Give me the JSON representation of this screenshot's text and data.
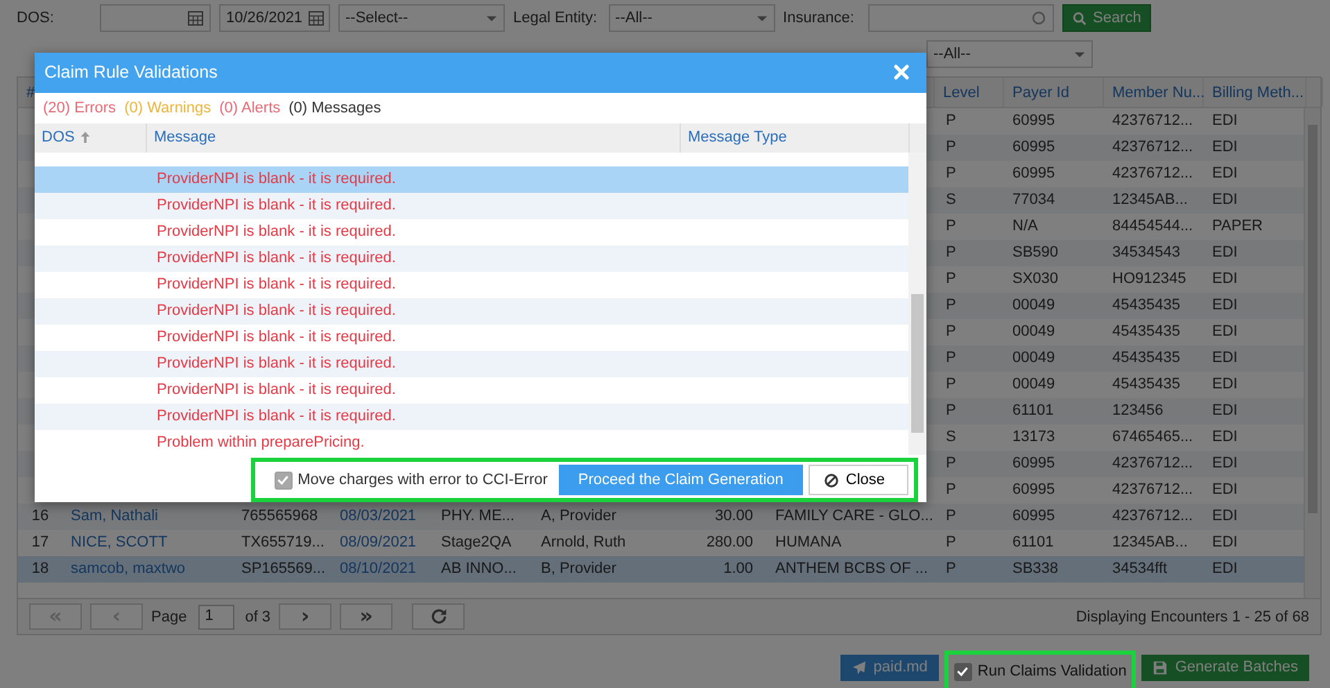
{
  "filters": {
    "rows": [
      [
        {
          "kind": "label",
          "text": "DOS:"
        },
        {
          "kind": "date"
        },
        {
          "kind": "date",
          "value": "10/26/2021"
        },
        {
          "kind": "select",
          "value": "--Select--"
        },
        {
          "kind": "label",
          "text": "Legal Entity:"
        },
        {
          "kind": "select",
          "value": "--All--"
        },
        {
          "kind": "label",
          "text": "Insurance:"
        },
        {
          "kind": "text"
        },
        {
          "kind": "button",
          "text": "Search"
        }
      ],
      [
        {
          "kind": "select",
          "value": "--All--"
        }
      ]
    ]
  },
  "grid": {
    "header": {
      "number": "#",
      "level": "Level",
      "payer_id": "Payer Id",
      "member_number": "Member Nu...",
      "billing_method": "Billing Meth..."
    },
    "rows": [
      {
        "selected": false,
        "level": "P",
        "payer_id": "60995",
        "member_number": "42376712...",
        "billing_method": "EDI"
      },
      {
        "selected": false,
        "level": "P",
        "payer_id": "60995",
        "member_number": "42376712...",
        "billing_method": "EDI"
      },
      {
        "selected": false,
        "level": "P",
        "payer_id": "60995",
        "member_number": "42376712...",
        "billing_method": "EDI"
      },
      {
        "selected": false,
        "level": "S",
        "payer_id": "77034",
        "member_number": "12345AB...",
        "billing_method": "EDI"
      },
      {
        "selected": false,
        "level": "P",
        "payer_id": "N/A",
        "member_number": "84454544...",
        "billing_method": "PAPER"
      },
      {
        "selected": false,
        "level": "P",
        "payer_id": "SB590",
        "member_number": "34534543",
        "billing_method": "EDI"
      },
      {
        "selected": false,
        "level": "P",
        "payer_id": "SX030",
        "member_number": "HO912345",
        "billing_method": "EDI"
      },
      {
        "selected": false,
        "level": "P",
        "payer_id": "00049",
        "member_number": "45435435",
        "billing_method": "EDI"
      },
      {
        "selected": false,
        "level": "P",
        "payer_id": "00049",
        "member_number": "45435435",
        "billing_method": "EDI"
      },
      {
        "selected": false,
        "level": "P",
        "payer_id": "00049",
        "member_number": "45435435",
        "billing_method": "EDI"
      },
      {
        "selected": false,
        "level": "P",
        "payer_id": "00049",
        "member_number": "45435435",
        "billing_method": "EDI"
      },
      {
        "selected": false,
        "level": "P",
        "payer_id": "61101",
        "member_number": "123456",
        "billing_method": "EDI"
      },
      {
        "selected": false,
        "level": "S",
        "payer_id": "13173",
        "member_number": "67465465...",
        "billing_method": "EDI"
      },
      {
        "selected": false,
        "level": "P",
        "payer_id": "60995",
        "member_number": "42376712...",
        "billing_method": "EDI"
      },
      {
        "selected": false,
        "level": "P",
        "payer_id": "60995",
        "member_number": "42376712...",
        "billing_method": "EDI"
      },
      {
        "selected": false,
        "number": "16",
        "patient": "Sam, Nathali",
        "account": "765565968",
        "dos": "08/03/2021",
        "column_5": "PHY. ME...",
        "provider": "A, Provider",
        "amount": "30.00",
        "insurance": "FAMILY CARE - GLO...",
        "level": "P",
        "payer_id": "60995",
        "member_number": "42376712...",
        "billing_method": "EDI"
      },
      {
        "selected": false,
        "number": "17",
        "patient": "NICE, SCOTT",
        "account": "TX655719...",
        "dos": "08/09/2021",
        "column_5": "Stage2QA",
        "provider": "Arnold, Ruth",
        "amount": "280.00",
        "insurance": "HUMANA",
        "level": "P",
        "payer_id": "61101",
        "member_number": "12345AB...",
        "billing_method": "EDI"
      },
      {
        "selected": true,
        "number": "18",
        "patient": "samcob, maxtwo",
        "account": "SP165569...",
        "dos": "08/10/2021",
        "column_5": "AB INNO...",
        "provider": "B, Provider",
        "amount": "1.00",
        "insurance": "ANTHEM BCBS OF ...",
        "level": "P",
        "payer_id": "SB338",
        "member_number": "34534fft",
        "billing_method": "EDI"
      }
    ]
  },
  "pager": {
    "nav_before": [
      {
        "text": "«",
        "disabled": true
      },
      {
        "text": "‹",
        "disabled": true
      }
    ],
    "page_label": "Page",
    "page": "1",
    "of": "of 3",
    "nav_after": [
      {
        "text": "›",
        "disabled": false
      },
      {
        "text": "»",
        "disabled": false
      }
    ],
    "status": "Displaying Encounters 1 - 25 of 68"
  },
  "actions": [
    {
      "kind": "send",
      "label": "paid.md"
    },
    {
      "kind": "checkbox",
      "label": "Run Claims Validation",
      "checked": true,
      "highlighted": true
    },
    {
      "kind": "save",
      "label": "Generate Batches"
    }
  ],
  "dialog": {
    "title": "Claim Rule Validations",
    "counts": [
      {
        "kind": "error",
        "text": "(20) Errors"
      },
      {
        "kind": "warning",
        "text": "(0) Warnings"
      },
      {
        "kind": "alert",
        "text": "(0) Alerts"
      },
      {
        "kind": "message",
        "text": "(0) Messages"
      }
    ],
    "columns": [
      {
        "label": "DOS",
        "sorted": true
      },
      {
        "label": "Message",
        "sorted": false
      },
      {
        "label": "Message Type",
        "sorted": false
      }
    ],
    "messages": [
      {
        "text": "ProviderNPI is blank - it is required.",
        "selected": true
      },
      {
        "text": "ProviderNPI is blank - it is required.",
        "selected": false
      },
      {
        "text": "ProviderNPI is blank - it is required.",
        "selected": false
      },
      {
        "text": "ProviderNPI is blank - it is required.",
        "selected": false
      },
      {
        "text": "ProviderNPI is blank - it is required.",
        "selected": false
      },
      {
        "text": "ProviderNPI is blank - it is required.",
        "selected": false
      },
      {
        "text": "ProviderNPI is blank - it is required.",
        "selected": false
      },
      {
        "text": "ProviderNPI is blank - it is required.",
        "selected": false
      },
      {
        "text": "ProviderNPI is blank - it is required.",
        "selected": false
      },
      {
        "text": "ProviderNPI is blank - it is required.",
        "selected": false
      },
      {
        "text": "Problem within preparePricing.",
        "selected": false
      }
    ],
    "footer": {
      "highlighted": true,
      "checkbox": {
        "label": "Move charges with error to CCI-Error",
        "checked": true
      },
      "buttons": [
        {
          "kind": "primary",
          "label": "Proceed the Claim Generation"
        },
        {
          "kind": "close",
          "label": "Close"
        }
      ]
    }
  }
}
